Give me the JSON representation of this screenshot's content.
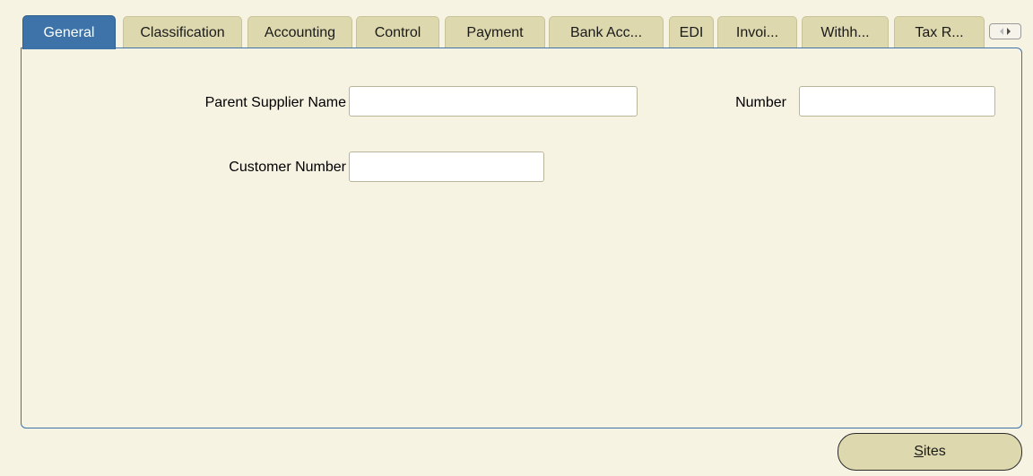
{
  "tabs": [
    {
      "label": "General",
      "active": true
    },
    {
      "label": "Classification",
      "active": false
    },
    {
      "label": "Accounting",
      "active": false
    },
    {
      "label": "Control",
      "active": false
    },
    {
      "label": "Payment",
      "active": false
    },
    {
      "label": "Bank Acc...",
      "active": false
    },
    {
      "label": "EDI",
      "active": false
    },
    {
      "label": "Invoi...",
      "active": false
    },
    {
      "label": "Withh...",
      "active": false
    },
    {
      "label": "Tax R...",
      "active": false
    }
  ],
  "tab_scroll_icon": "tab-scroll-arrows-icon",
  "form": {
    "parent_supplier_name": {
      "label": "Parent Supplier Name",
      "value": ""
    },
    "number": {
      "label": "Number",
      "value": ""
    },
    "customer_number": {
      "label": "Customer Number",
      "value": ""
    }
  },
  "buttons": {
    "sites_mnemonic": "S",
    "sites_rest": "ites"
  },
  "colors": {
    "background": "#f7f3e3",
    "tab_inactive": "#ddd8ae",
    "tab_active": "#3d73a8",
    "panel_border": "#3d73a8"
  }
}
